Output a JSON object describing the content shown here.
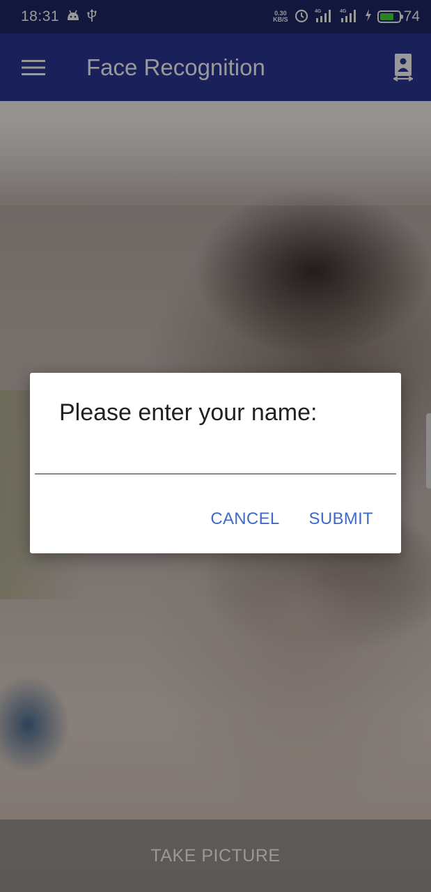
{
  "status_bar": {
    "time": "18:31",
    "net_speed_value": "0.30",
    "net_speed_unit": "KB/S",
    "signal_1_label": "4G",
    "signal_2_label": "4G",
    "battery_level": "74",
    "icons": [
      "android-icon",
      "usb-icon",
      "alarm-icon",
      "signal-icon",
      "signal-icon",
      "charging-icon",
      "battery-icon"
    ]
  },
  "app_bar": {
    "title": "Face Recognition",
    "menu_icon": "hamburger-menu-icon",
    "action_icon": "switch-camera-icon",
    "color": "#2b3697"
  },
  "dialog": {
    "title": "Please enter your name:",
    "input_value": "",
    "cancel_label": "CANCEL",
    "submit_label": "SUBMIT",
    "action_color": "#3f6bc4"
  },
  "bottom_bar": {
    "take_picture_label": "TAKE PICTURE"
  }
}
